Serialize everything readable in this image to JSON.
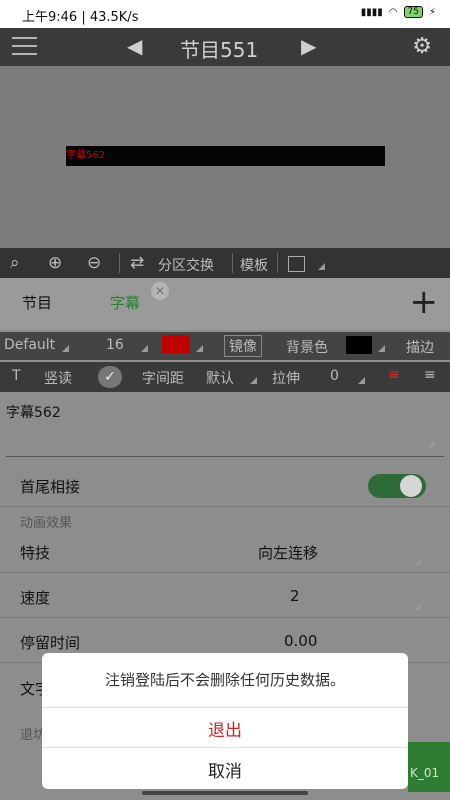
{
  "status": {
    "time": "上午9:46 | 43.5K/s",
    "battery": "75"
  },
  "appbar": {
    "title": "节目551",
    "prev_icon": "prev-arrow-icon",
    "next_icon": "next-arrow-icon",
    "settings_icon": "gear-icon"
  },
  "preview": {
    "subtitle_text": "字幕562"
  },
  "toolbar": {
    "partition_swap": "分区交换",
    "template": "模板"
  },
  "tabs": {
    "program": "节目",
    "subtitle": "字幕"
  },
  "style_row": {
    "font": "Default",
    "size": "16",
    "color": "#c00000",
    "mirror": "镜像",
    "bg_color": "背景色",
    "stroke": "描边"
  },
  "style_row2": {
    "t": "T",
    "vertical": "竖读",
    "spacing": "字间距",
    "spacing_value": "默认",
    "stretch": "拉伸",
    "stretch_value": "0"
  },
  "content": {
    "text_value": "字幕562",
    "head_tail": "首尾相接",
    "animation_section": "动画效果",
    "effect_label": "特技",
    "effect_value": "向左连移",
    "speed_label": "速度",
    "speed_value": "2",
    "stay_label": "停留时间",
    "stay_value": "0.00",
    "partial_label1": "文字",
    "partial_label2": "退坊",
    "partial_right": "K_01"
  },
  "dialog": {
    "message": "注销登陆后不会删除任何历史数据。",
    "confirm": "退出",
    "cancel": "取消",
    "confirm_color": "#c62828"
  }
}
